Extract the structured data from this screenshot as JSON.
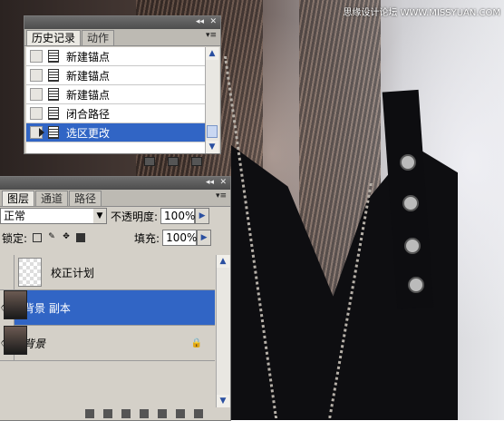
{
  "watermark": "思缘设计论坛 WWW.MISSYUAN.COM",
  "history_panel": {
    "tabs": [
      "历史记录",
      "动作"
    ],
    "items": [
      {
        "label": "新建锚点",
        "selected": false
      },
      {
        "label": "新建锚点",
        "selected": false
      },
      {
        "label": "新建锚点",
        "selected": false
      },
      {
        "label": "闭合路径",
        "selected": false
      },
      {
        "label": "选区更改",
        "selected": true
      }
    ],
    "footer_icons": [
      "new-document-icon",
      "camera-icon",
      "trash-icon"
    ]
  },
  "layers_panel": {
    "tabs": [
      "图层",
      "通道",
      "路径"
    ],
    "blend_mode": "正常",
    "opacity_label": "不透明度:",
    "opacity_value": "100%",
    "lock_label": "锁定:",
    "fill_label": "填充:",
    "fill_value": "100%",
    "layers": [
      {
        "name": "校正计划",
        "visible": false,
        "selected": false,
        "locked": false
      },
      {
        "name": "背景 副本",
        "visible": true,
        "selected": true,
        "locked": false
      },
      {
        "name": "背景",
        "visible": true,
        "selected": false,
        "locked": true
      }
    ]
  },
  "colors": {
    "selection": "#3165c5",
    "panel": "#d4d0c8"
  }
}
